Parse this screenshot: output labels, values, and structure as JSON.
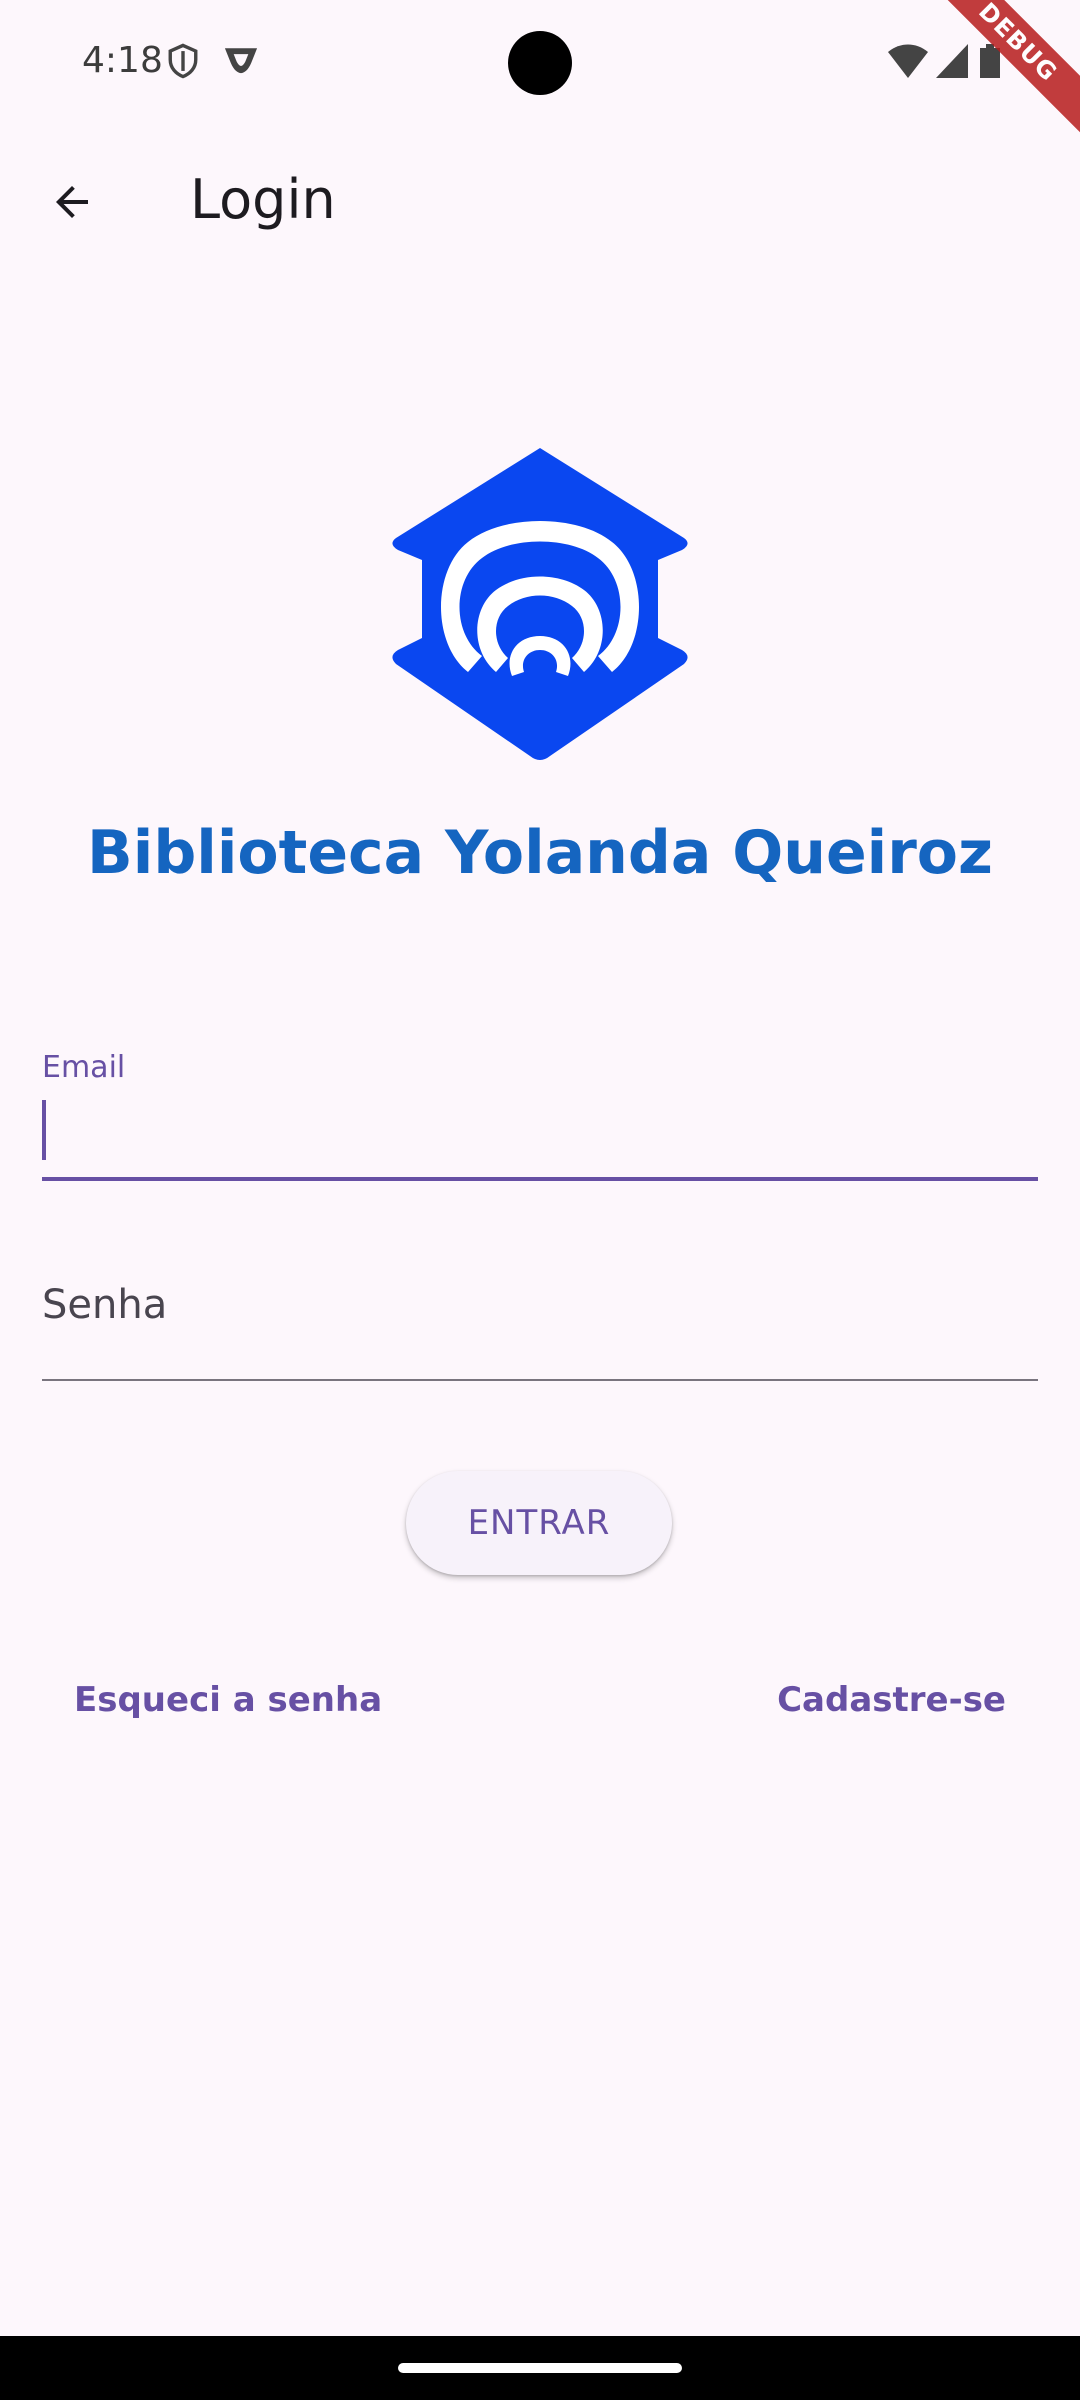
{
  "status_bar": {
    "time": "4:18",
    "icons": [
      "shield-icon",
      "vpn-icon",
      "wifi-icon",
      "signal-icon",
      "battery-icon"
    ]
  },
  "debug_banner": "DEBUG",
  "app_bar": {
    "title": "Login",
    "back_icon": "arrow-back-icon"
  },
  "brand": {
    "title": "Biblioteca Yolanda Queiroz",
    "logo": "library-logo",
    "color": "#1565c0",
    "logo_color": "#0a47f0"
  },
  "form": {
    "email_label": "Email",
    "email_value": "",
    "password_label": "Senha",
    "password_value": "",
    "submit_label": "ENTRAR"
  },
  "links": {
    "forgot": "Esqueci a senha",
    "signup": "Cadastre-se"
  },
  "theme": {
    "accent": "#6750a4",
    "background": "#fdf7fc"
  }
}
